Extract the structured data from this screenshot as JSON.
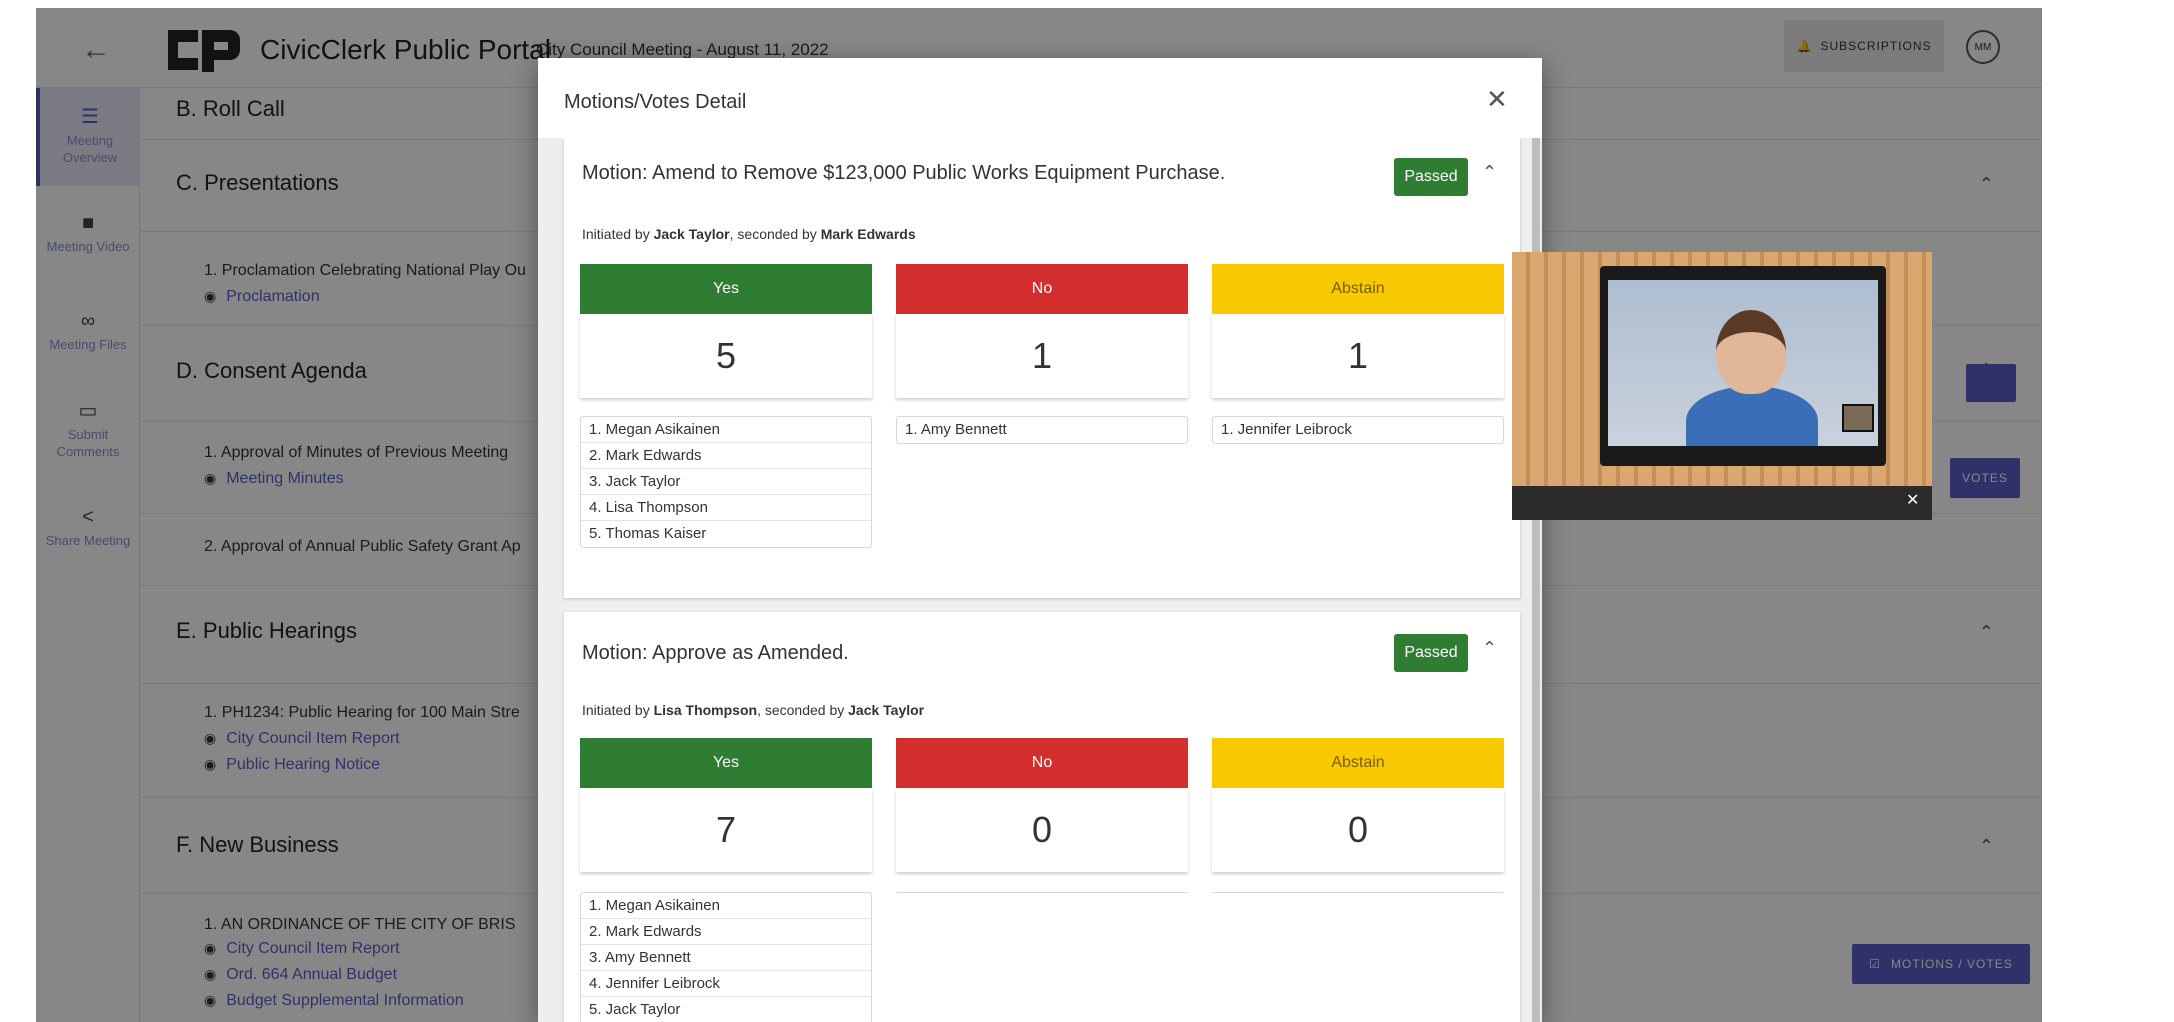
{
  "app": {
    "back_icon": "arrow-left-icon",
    "portal_title": "CivicClerk Public Portal",
    "meeting_title": "City Council Meeting - August 11, 2022",
    "subscriptions_label": "SUBSCRIPTIONS",
    "avatar_initials": "MM"
  },
  "sidebar": {
    "items": [
      {
        "label": "Meeting Overview",
        "icon": "list-icon",
        "active": true
      },
      {
        "label": "Meeting Video",
        "icon": "video-icon",
        "active": false
      },
      {
        "label": "Meeting Files",
        "icon": "link-icon",
        "active": false
      },
      {
        "label": "Submit Comments",
        "icon": "comment-icon",
        "active": false
      },
      {
        "label": "Share Meeting",
        "icon": "share-icon",
        "active": false
      }
    ]
  },
  "agenda": {
    "sections": [
      {
        "title": "B. Roll Call"
      },
      {
        "title": "C. Presentations",
        "items": [
          {
            "text": "1. Proclamation Celebrating National Play Ou",
            "attachments": [
              "Proclamation"
            ]
          }
        ]
      },
      {
        "title": "D. Consent Agenda",
        "items": [
          {
            "text": "1. Approval of Minutes of Previous Meeting",
            "attachments": [
              "Meeting Minutes"
            ]
          },
          {
            "text": "2. Approval of Annual Public Safety Grant Ap",
            "attachments": []
          }
        ]
      },
      {
        "title": "E. Public Hearings",
        "items": [
          {
            "text": "1. PH1234: Public Hearing for 100 Main Stre",
            "attachments": [
              "City Council Item Report",
              "Public Hearing Notice"
            ]
          }
        ]
      },
      {
        "title": "F. New Business",
        "items": [
          {
            "text": "1. AN ORDINANCE OF THE CITY OF BRIS",
            "attachments": [
              "City Council Item Report",
              "Ord. 664 Annual Budget",
              "Budget Supplemental Information"
            ]
          }
        ]
      }
    ],
    "votes_button_short": "VOTES",
    "motions_votes_button": "MOTIONS / VOTES"
  },
  "modal": {
    "title": "Motions/Votes Detail",
    "close_icon": "close-icon",
    "motions": [
      {
        "title": "Motion: Amend to Remove $123,000 Public Works Equipment Purchase.",
        "status": "Passed",
        "initiated_prefix": "Initiated by ",
        "initiated_by": "Jack Taylor",
        "seconded_prefix": ", seconded by ",
        "seconded_by": "Mark Edwards",
        "yes": {
          "label": "Yes",
          "count": "5",
          "names": [
            "1. Megan Asikainen",
            "2. Mark Edwards",
            "3. Jack Taylor",
            "4. Lisa Thompson",
            "5. Thomas Kaiser"
          ]
        },
        "no": {
          "label": "No",
          "count": "1",
          "names": [
            "1. Amy Bennett"
          ]
        },
        "abstain": {
          "label": "Abstain",
          "count": "1",
          "names": [
            "1. Jennifer Leibrock"
          ]
        }
      },
      {
        "title": "Motion: Approve as Amended.",
        "status": "Passed",
        "initiated_prefix": "Initiated by ",
        "initiated_by": "Lisa Thompson",
        "seconded_prefix": ", seconded by ",
        "seconded_by": "Jack Taylor",
        "yes": {
          "label": "Yes",
          "count": "7",
          "names": [
            "1. Megan Asikainen",
            "2. Mark Edwards",
            "3. Amy Bennett",
            "4. Jennifer Leibrock",
            "5. Jack Taylor"
          ]
        },
        "no": {
          "label": "No",
          "count": "0",
          "names": []
        },
        "abstain": {
          "label": "Abstain",
          "count": "0",
          "names": []
        }
      }
    ]
  },
  "video": {
    "close_icon": "close-icon"
  },
  "colors": {
    "accent": "#5a5fc4",
    "yes": "#2e7d32",
    "no": "#d32f2f",
    "abstain": "#f9c900",
    "passed": "#2e7d32"
  }
}
